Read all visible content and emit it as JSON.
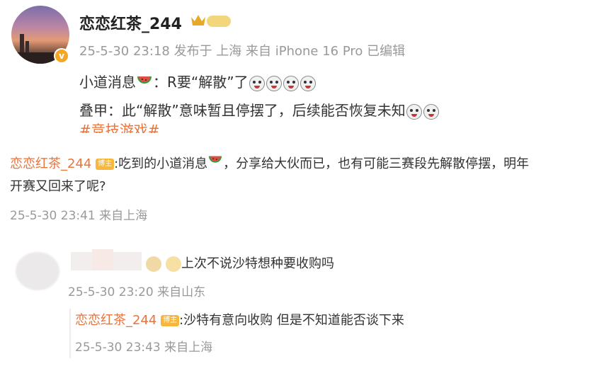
{
  "post": {
    "author": "恋恋红茶_244",
    "meta": "25-5-30 23:18 发布于 上海 来自 iPhone 16 Pro 已编辑",
    "line1_prefix": "小道消息",
    "line1_suffix": "：R要“解散”了",
    "line2": "叠甲：此“解散”意味暂且停摆了，后续能否恢复未知",
    "hashtag": "#竞技游戏#"
  },
  "comment1": {
    "author": "恋恋红茶_244",
    "badge": "博主",
    "text_a": ":吃到的小道消息",
    "text_b": "，分享给大伙而已，也有可能三赛段先解散停摆，明年",
    "text_c": "开赛又回来了呢?",
    "meta": "25-5-30 23:41 来自上海"
  },
  "reply1": {
    "text": "上次不说沙特想种要收购吗",
    "meta": "25-5-30 23:20 来自山东"
  },
  "reply2": {
    "author": "恋恋红茶_244",
    "badge": "博主",
    "text": ":沙特有意向收购 但是不知道能否谈下来",
    "meta": "25-5-30 23:43 来自上海"
  },
  "colors": {
    "author_orange": "#e8743b",
    "meta_gray": "#999999",
    "badge_yellow": "#f6b73c"
  }
}
